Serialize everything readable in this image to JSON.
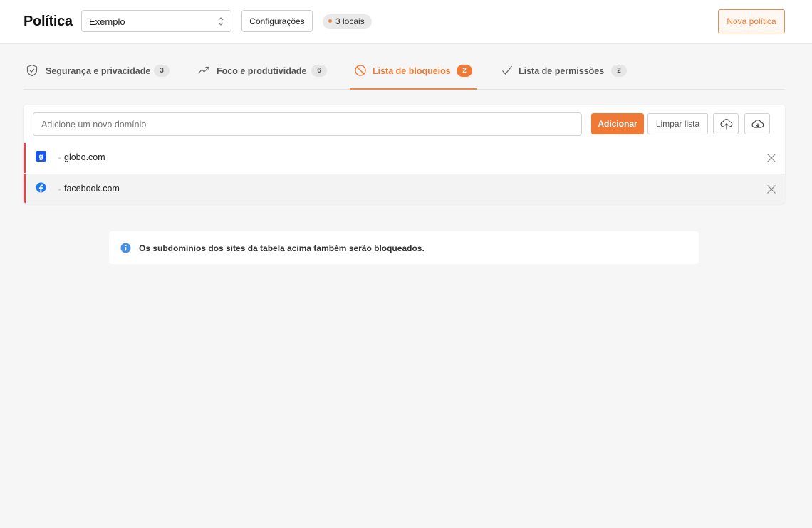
{
  "header": {
    "title": "Política",
    "policy_select": {
      "value": "Exemplo",
      "icon": "chevron-up-down-icon"
    },
    "config_label": "Configurações",
    "locations_badge": "3 locais",
    "new_policy_label": "Nova política"
  },
  "tabs": [
    {
      "label": "Segurança e privacidade",
      "count": "3",
      "icon": "shield-check-icon",
      "active": false
    },
    {
      "label": "Foco e produtividade",
      "count": "6",
      "icon": "trend-up-icon",
      "active": false
    },
    {
      "label": "Lista de bloqueios",
      "count": "2",
      "icon": "block-icon",
      "active": true
    },
    {
      "label": "Lista de permissões",
      "count": "2",
      "icon": "check-icon",
      "active": false
    }
  ],
  "blocklist": {
    "input": {
      "value": "",
      "placeholder": "Adicione um novo domínio"
    },
    "add_label": "Adicionar",
    "clear_label": "Limpar lista",
    "upload_icon": "cloud-upload-icon",
    "download_icon": "cloud-download-icon",
    "rows": [
      {
        "domain": "globo.com",
        "favicon": "globo-favicon-icon",
        "favicon_color": "#1a56e8"
      },
      {
        "domain": "facebook.com",
        "favicon": "facebook-favicon-icon",
        "favicon_color": "#1877f2"
      }
    ],
    "row_accent_color": "#e0454f"
  },
  "info": {
    "icon": "info-icon",
    "text": "Os subdomínios dos sites da tabela acima também serão bloqueados."
  },
  "colors": {
    "accent": "#f07a35",
    "info": "#4a8fe0"
  }
}
